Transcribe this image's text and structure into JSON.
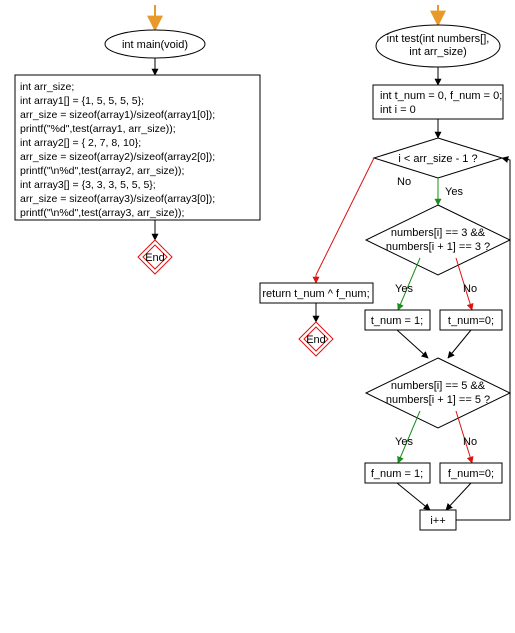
{
  "left": {
    "start_label": "int main(void)",
    "code_lines": [
      "int arr_size;",
      "int array1[] = {1, 5, 5, 5, 5};",
      "arr_size = sizeof(array1)/sizeof(array1[0]);",
      "printf(\"%d\",test(array1, arr_size));",
      "int array2[] = { 2, 7, 8, 10};",
      "arr_size = sizeof(array2)/sizeof(array2[0]);",
      "printf(\"\\n%d\",test(array2, arr_size));",
      "int array3[] = {3, 3, 3, 5, 5, 5};",
      "arr_size = sizeof(array3)/sizeof(array3[0]);",
      "printf(\"\\n%d\",test(array3, arr_size));"
    ],
    "end_label": "End"
  },
  "right": {
    "start_label_l1": "int test(int numbers[],",
    "start_label_l2": "int arr_size)",
    "init_l1": "int t_num = 0, f_num = 0;",
    "init_l2": "int i = 0",
    "cond1": "i < arr_size - 1 ?",
    "cond2_l1": "numbers[i] == 3 &&",
    "cond2_l2": "numbers[i + 1] == 3 ?",
    "t1_yes": "t_num = 1;",
    "t1_no": "t_num=0;",
    "cond3_l1": "numbers[i] == 5 &&",
    "cond3_l2": "numbers[i + 1] == 5 ?",
    "f1_yes": "f_num = 1;",
    "f1_no": "f_num=0;",
    "inc": "i++",
    "return": "return t_num ^ f_num;",
    "end_label": "End",
    "yes": "Yes",
    "no": "No"
  },
  "chart_data": {
    "type": "flowchart",
    "functions": [
      {
        "name": "main",
        "nodes": [
          {
            "id": "m_start",
            "kind": "start",
            "label": "int main(void)"
          },
          {
            "id": "m_body",
            "kind": "process",
            "label": "int arr_size;\nint array1[] = {1, 5, 5, 5, 5};\narr_size = sizeof(array1)/sizeof(array1[0]);\nprintf(\"%d\",test(array1, arr_size));\nint array2[] = { 2, 7, 8, 10};\narr_size = sizeof(array2)/sizeof(array2[0]);\nprintf(\"\\n%d\",test(array2, arr_size));\nint array3[] = {3, 3, 3, 5, 5, 5};\narr_size = sizeof(array3)/sizeof(array3[0]);\nprintf(\"\\n%d\",test(array3, arr_size));"
          },
          {
            "id": "m_end",
            "kind": "end",
            "label": "End"
          }
        ],
        "edges": [
          {
            "from": "m_start",
            "to": "m_body"
          },
          {
            "from": "m_body",
            "to": "m_end"
          }
        ]
      },
      {
        "name": "test",
        "nodes": [
          {
            "id": "t_start",
            "kind": "start",
            "label": "int test(int numbers[], int arr_size)"
          },
          {
            "id": "t_init",
            "kind": "process",
            "label": "int t_num = 0, f_num = 0;\nint i = 0"
          },
          {
            "id": "t_c1",
            "kind": "decision",
            "label": "i < arr_size - 1 ?"
          },
          {
            "id": "t_ret",
            "kind": "process",
            "label": "return t_num ^ f_num;"
          },
          {
            "id": "t_end",
            "kind": "end",
            "label": "End"
          },
          {
            "id": "t_c2",
            "kind": "decision",
            "label": "numbers[i] == 3 && numbers[i + 1] == 3 ?"
          },
          {
            "id": "t_t1y",
            "kind": "process",
            "label": "t_num = 1;"
          },
          {
            "id": "t_t1n",
            "kind": "process",
            "label": "t_num=0;"
          },
          {
            "id": "t_c3",
            "kind": "decision",
            "label": "numbers[i] == 5 && numbers[i + 1] == 5 ?"
          },
          {
            "id": "t_f1y",
            "kind": "process",
            "label": "f_num = 1;"
          },
          {
            "id": "t_f1n",
            "kind": "process",
            "label": "f_num=0;"
          },
          {
            "id": "t_inc",
            "kind": "process",
            "label": "i++"
          }
        ],
        "edges": [
          {
            "from": "t_start",
            "to": "t_init"
          },
          {
            "from": "t_init",
            "to": "t_c1"
          },
          {
            "from": "t_c1",
            "to": "t_c2",
            "label": "Yes"
          },
          {
            "from": "t_c1",
            "to": "t_ret",
            "label": "No"
          },
          {
            "from": "t_ret",
            "to": "t_end"
          },
          {
            "from": "t_c2",
            "to": "t_t1y",
            "label": "Yes"
          },
          {
            "from": "t_c2",
            "to": "t_t1n",
            "label": "No"
          },
          {
            "from": "t_t1y",
            "to": "t_c3"
          },
          {
            "from": "t_t1n",
            "to": "t_c3"
          },
          {
            "from": "t_c3",
            "to": "t_f1y",
            "label": "Yes"
          },
          {
            "from": "t_c3",
            "to": "t_f1n",
            "label": "No"
          },
          {
            "from": "t_f1y",
            "to": "t_inc"
          },
          {
            "from": "t_f1n",
            "to": "t_inc"
          },
          {
            "from": "t_inc",
            "to": "t_c1"
          }
        ]
      }
    ]
  }
}
